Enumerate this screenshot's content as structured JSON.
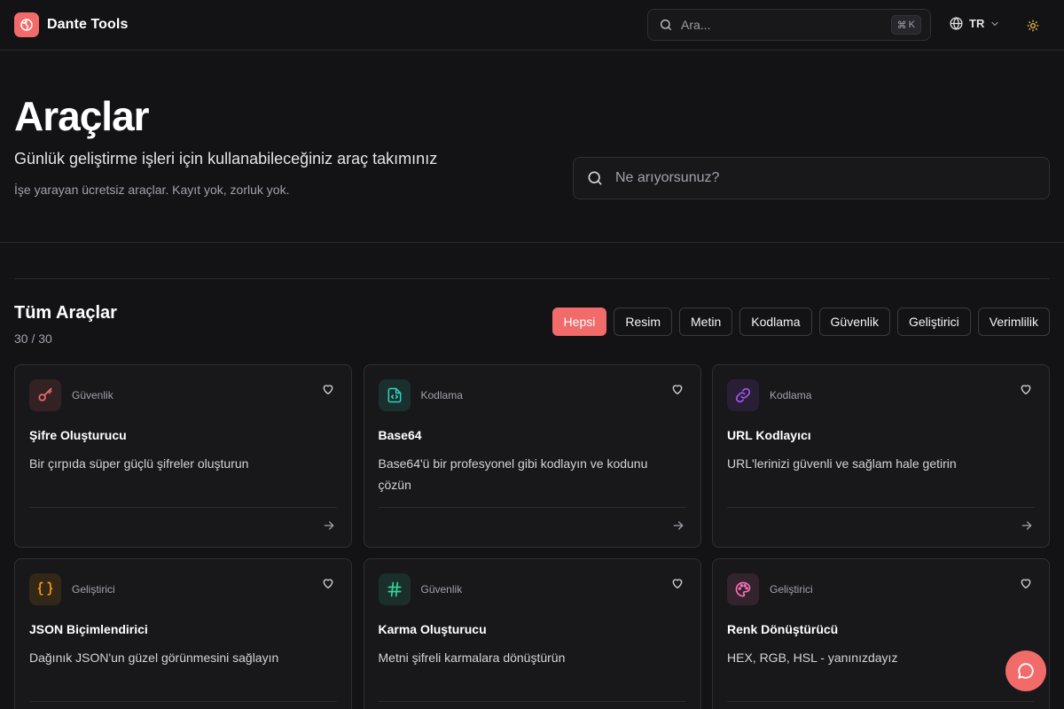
{
  "header": {
    "brand": "Dante Tools",
    "search_placeholder": "Ara...",
    "shortcut_symbol": "⌘",
    "shortcut_key": "K",
    "language": "TR"
  },
  "hero": {
    "title": "Araçlar",
    "subtitle": "Günlük geliştirme işleri için kullanabileceğiniz araç takımınız",
    "note": "İşe yarayan ücretsiz araçlar. Kayıt yok, zorluk yok.",
    "search_placeholder": "Ne arıyorsunuz?"
  },
  "section": {
    "title": "Tüm Araçlar",
    "count": "30 / 30"
  },
  "filters": [
    "Hepsi",
    "Resim",
    "Metin",
    "Kodlama",
    "Güvenlik",
    "Geliştirici",
    "Verimlilik"
  ],
  "active_filter": "Hepsi",
  "cards": [
    {
      "category": "Güvenlik",
      "title": "Şifre Oluşturucu",
      "description": "Bir çırpıda süper güçlü şifreler oluşturun",
      "icon": "key-icon",
      "accent": "#f26b6b"
    },
    {
      "category": "Kodlama",
      "title": "Base64",
      "description": "Base64'ü bir profesyonel gibi kodlayın ve kodunu çözün",
      "icon": "file-code-icon",
      "accent": "#2dd4bf"
    },
    {
      "category": "Kodlama",
      "title": "URL Kodlayıcı",
      "description": "URL'lerinizi güvenli ve sağlam hale getirin",
      "icon": "link-icon",
      "accent": "#a855f7"
    },
    {
      "category": "Geliştirici",
      "title": "JSON Biçimlendirici",
      "description": "Dağınık JSON'un güzel görünmesini sağlayın",
      "icon": "braces-icon",
      "accent": "#f59e0b"
    },
    {
      "category": "Güvenlik",
      "title": "Karma Oluşturucu",
      "description": "Metni şifreli karmalara dönüştürün",
      "icon": "hash-icon",
      "accent": "#34d399"
    },
    {
      "category": "Geliştirici",
      "title": "Renk Dönüştürücü",
      "description": "HEX, RGB, HSL - yanınızdayız",
      "icon": "palette-icon",
      "accent": "#f472b6"
    }
  ],
  "colors": {
    "background": "#131316",
    "card": "#18181b",
    "border": "#2f2f35",
    "accent": "#f26b6b"
  }
}
